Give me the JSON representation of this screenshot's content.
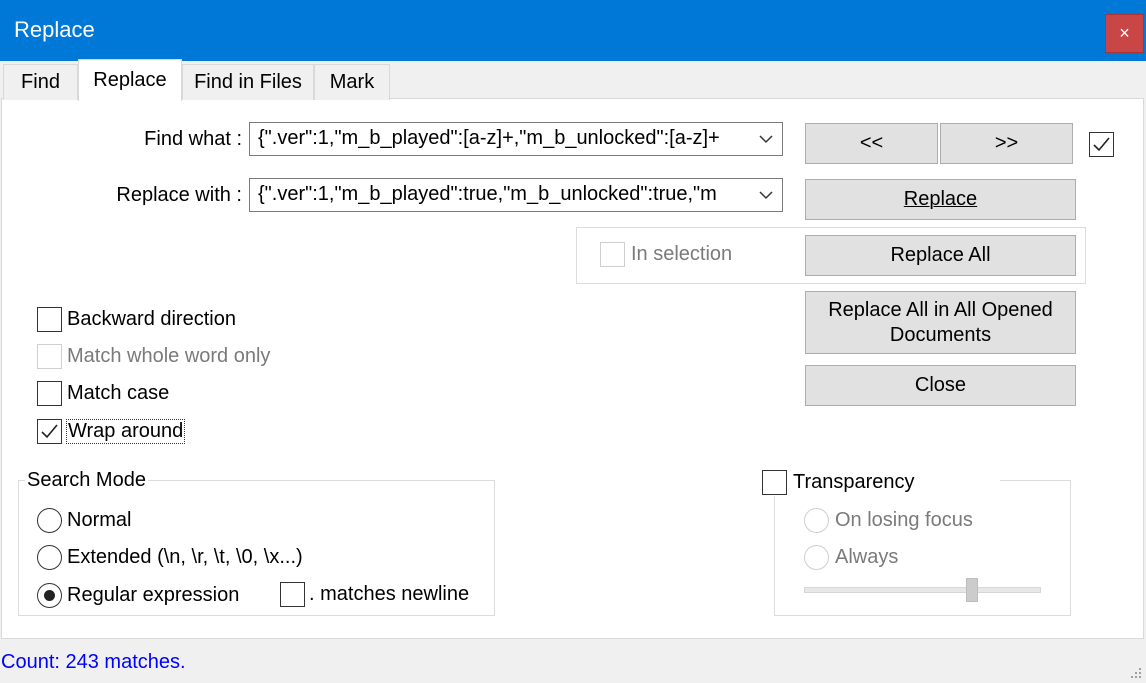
{
  "window": {
    "title": "Replace",
    "close_glyph": "×"
  },
  "tabs": [
    {
      "label": "Find"
    },
    {
      "label": "Replace"
    },
    {
      "label": "Find in Files"
    },
    {
      "label": "Mark"
    }
  ],
  "find": {
    "label": "Find what :",
    "value": "{\".ver\":1,\"m_b_played\":[a-z]+,\"m_b_unlocked\":[a-z]+"
  },
  "replace": {
    "label": "Replace with :",
    "value": "{\".ver\":1,\"m_b_played\":true,\"m_b_unlocked\":true,\"m"
  },
  "buttons": {
    "prev": "<<",
    "next": ">>",
    "replace": "Replace",
    "replace_all": "Replace All",
    "replace_all_docs_line1": "Replace All in All Opened",
    "replace_all_docs_line2": "Documents",
    "close": "Close"
  },
  "in_selection": {
    "label": "In selection",
    "checked": false,
    "disabled": true
  },
  "options": {
    "backward": {
      "label": "Backward direction",
      "checked": false
    },
    "whole_word": {
      "label": "Match whole word only",
      "checked": false,
      "disabled": true
    },
    "match_case": {
      "label": "Match case",
      "checked": false
    },
    "wrap_around": {
      "label": "Wrap around",
      "checked": true
    }
  },
  "search_mode": {
    "title": "Search Mode",
    "normal": "Normal",
    "extended": "Extended (\\n, \\r, \\t, \\0, \\x...)",
    "regex": "Regular expression",
    "selected": "regex",
    "matches_newline": ". matches newline"
  },
  "transparency": {
    "label": "Transparency",
    "checked": false,
    "on_losing_focus": "On losing focus",
    "always": "Always"
  },
  "status": {
    "text": "Count: 243 matches."
  }
}
